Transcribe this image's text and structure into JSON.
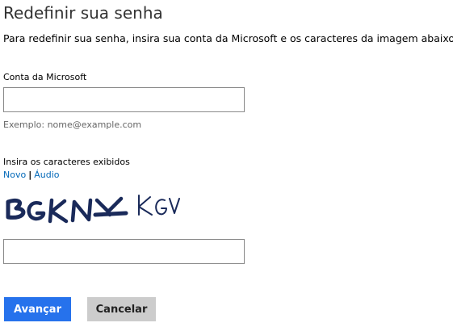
{
  "header": {
    "title": "Redefinir sua senha",
    "intro": "Para redefinir sua senha, insira sua conta da Microsoft e os caracteres da imagem abaixo."
  },
  "account": {
    "label": "Conta da Microsoft",
    "value": "",
    "hint": "Exemplo: nome@example.com"
  },
  "captcha": {
    "label": "Insira os caracteres exibidos",
    "new_link": "Novo",
    "separator": "|",
    "audio_link": "Áudio",
    "image_text": "BGKNYKGV",
    "value": ""
  },
  "actions": {
    "next_label": "Avançar",
    "cancel_label": "Cancelar"
  },
  "colors": {
    "primary_button": "#2672ec",
    "secondary_button": "#cccccc",
    "link": "#0067b8",
    "captcha_ink": "#1a2a5a"
  }
}
